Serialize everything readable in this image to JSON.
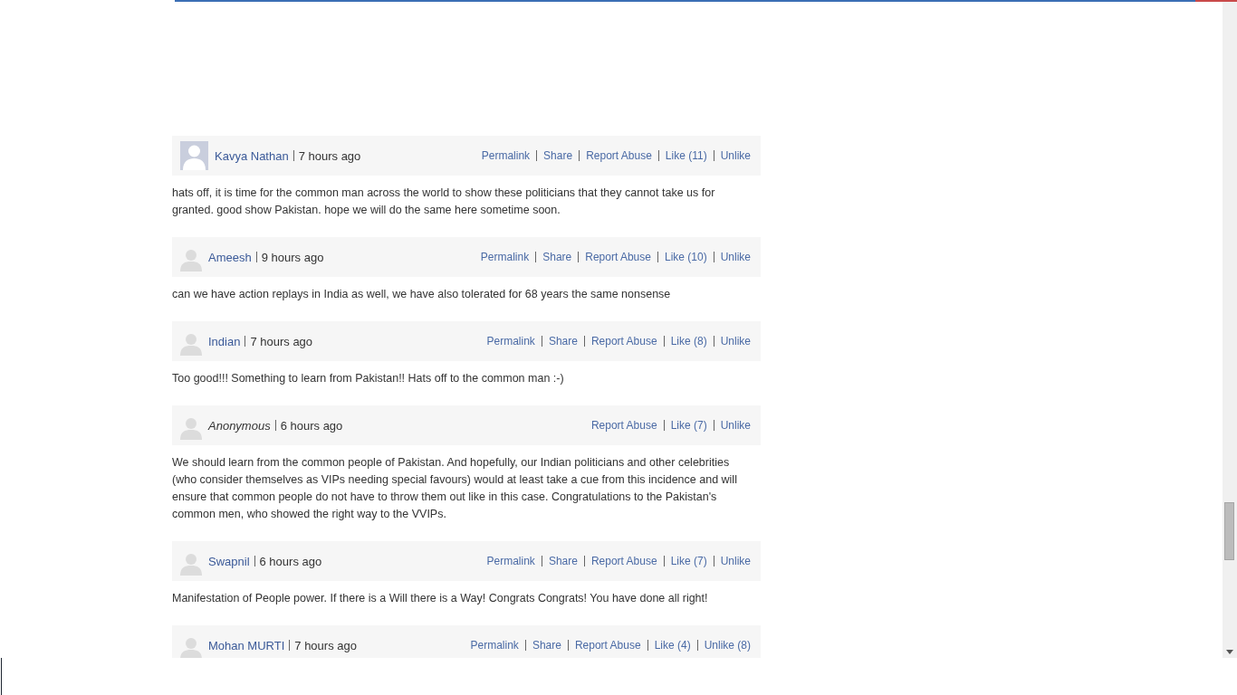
{
  "comments": [
    {
      "author": "Kavya Nathan",
      "anonymous": false,
      "kind": "photo",
      "time": "7 hours ago",
      "actions": [
        "Permalink",
        "Share",
        "Report Abuse",
        "Like (11)",
        "Unlike"
      ],
      "text": "hats off, it is time for the common man across the world to show these politicians that they cannot take us for granted. good show Pakistan. hope we will do the same here sometime soon."
    },
    {
      "author": "Ameesh",
      "anonymous": false,
      "kind": "default",
      "time": "9 hours ago",
      "actions": [
        "Permalink",
        "Share",
        "Report Abuse",
        "Like (10)",
        "Unlike"
      ],
      "text": "can we have action replays in India as well, we have also tolerated for 68 years the same nonsense"
    },
    {
      "author": "Indian",
      "anonymous": false,
      "kind": "default",
      "time": "7 hours ago",
      "actions": [
        "Permalink",
        "Share",
        "Report Abuse",
        "Like (8)",
        "Unlike"
      ],
      "text": "Too good!!! Something to learn from Pakistan!! Hats off to the common man :-)"
    },
    {
      "author": "Anonymous",
      "anonymous": true,
      "kind": "default",
      "time": "6 hours ago",
      "actions": [
        "Report Abuse",
        "Like (7)",
        "Unlike"
      ],
      "text": "We should learn from the common people of Pakistan. And hopefully, our Indian politicians and other celebrities (who consider themselves as VIPs needing special favours) would at least take a cue from this incidence and will ensure that common people do not have to throw them out like in this case. Congratulations to the Pakistan's common men, who showed the right way to the VVIPs."
    },
    {
      "author": "Swapnil",
      "anonymous": false,
      "kind": "default",
      "time": "6 hours ago",
      "actions": [
        "Permalink",
        "Share",
        "Report Abuse",
        "Like (7)",
        "Unlike"
      ],
      "text": "Manifestation of People power. If there is a Will there is a Way! Congrats Congrats! You have done all right!"
    },
    {
      "author": "Mohan MURTI",
      "anonymous": false,
      "kind": "default",
      "time": "7 hours ago",
      "actions": [
        "Permalink",
        "Share",
        "Report Abuse",
        "Like (4)",
        "Unlike (8)"
      ]
    }
  ]
}
